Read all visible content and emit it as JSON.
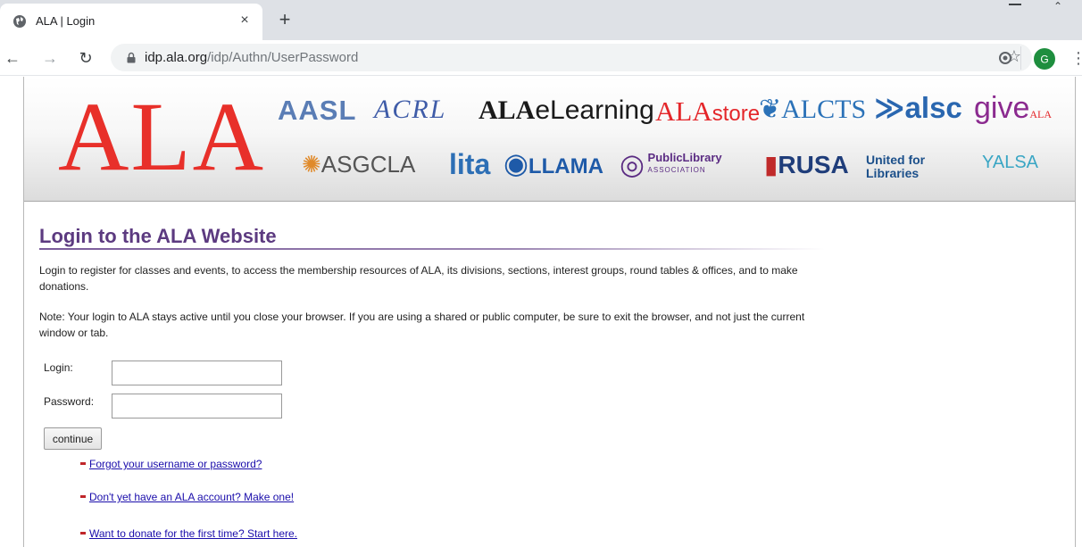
{
  "browser": {
    "tab_title": "ALA | Login",
    "tab_close": "×",
    "new_tab": "+",
    "url_host": "idp.ala.org",
    "url_path": "/idp/Authn/UserPassword",
    "avatar_letter": "G"
  },
  "banner": {
    "main_logo": "ALA",
    "logos_row1": [
      "AASL",
      "ACRL",
      "ALA eLearning",
      "ALAstore",
      "ALCTS",
      "alsc",
      "giveALA"
    ],
    "logos_row2": [
      "ASGCLA",
      "lita",
      "LLAMA",
      "Public Library Association",
      "RUSA",
      "United for Libraries",
      "YALSA"
    ],
    "aasl": "AASL",
    "acrl": "ACRL",
    "elearning_bold": "ALA",
    "elearning_rest": "eLearning",
    "store_a": "ALA",
    "store_b": "store",
    "alcts": "ALCTS",
    "alsc": "alsc",
    "give": "give",
    "give_sub": "ALA",
    "asgcla": "ASGCLA",
    "lita": "lita",
    "llama": "LLAMA",
    "pla_1": "PublicLibrary",
    "pla_2": "ASSOCIATION",
    "rusa": "RUSA",
    "united": "United for Libraries",
    "yalsa": "YALSA"
  },
  "content": {
    "title": "Login to the ALA Website",
    "intro": "Login to register for classes and events, to access the membership resources of ALA, its divisions, sections, interest groups, round tables & offices, and to make donations.",
    "note": "Note: Your login to ALA stays active until you close your browser. If you are using a shared or public computer, be sure to exit the browser, and not just the current window or tab."
  },
  "form": {
    "login_label": "Login:",
    "password_label": "Password:",
    "login_value": "",
    "password_value": "",
    "continue_label": "continue"
  },
  "links": {
    "forgot": "Forgot your username or password?",
    "create": "Don't yet have an ALA account? Make one!",
    "donate": "Want to donate for the first time? Start here."
  },
  "colors": {
    "ala_red": "#e8302a",
    "title_purple": "#5c3a80",
    "link_blue": "#1a0dab",
    "bullet_red": "#c0262a"
  }
}
